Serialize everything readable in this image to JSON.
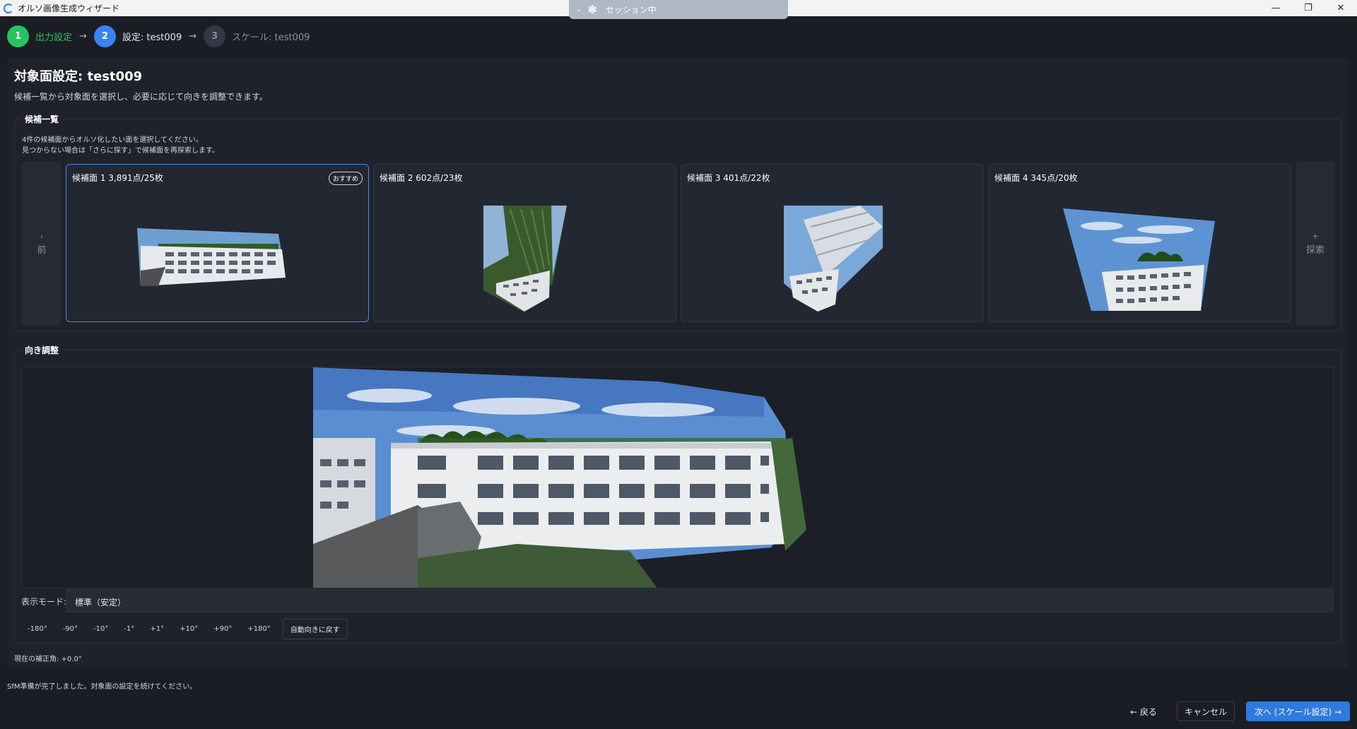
{
  "window": {
    "title": "オルソ画像生成ウィザード",
    "controls": [
      "—",
      "❐",
      "✕"
    ]
  },
  "session": {
    "label": "セッション中"
  },
  "steps": [
    {
      "number": "1",
      "label": "出力設定",
      "state": "done"
    },
    {
      "number": "2",
      "label": "設定: test009",
      "state": "active"
    },
    {
      "number": "3",
      "label": "スケール: test009",
      "state": "inactive"
    }
  ],
  "step_arrow": "→",
  "page": {
    "title": "対象面設定: test009",
    "description": "候補一覧から対象面を選択し、必要に応じて向きを調整できます。"
  },
  "candidates": {
    "group_title": "候補一覧",
    "hint_line1": "4件の候補面からオルソ化したい面を選択してください。",
    "hint_line2": "見つからない場合は「さらに探す」で候補面を再探索します。",
    "prev": {
      "symbol": "‹",
      "label": "前"
    },
    "explore": {
      "symbol": "+",
      "label": "探索"
    },
    "items": [
      {
        "label": "候補面 1 3,891点/25枚",
        "badge": "おすすめ",
        "selected": true
      },
      {
        "label": "候補面 2 602点/23枚",
        "selected": false
      },
      {
        "label": "候補面 3 401点/22枚",
        "selected": false
      },
      {
        "label": "候補面 4 345点/20枚",
        "selected": false
      }
    ]
  },
  "orientation": {
    "group_title": "向き調整",
    "mode_label": "表示モード:",
    "mode_value": "標準（安定）",
    "rotation_buttons": [
      "-180°",
      "-90°",
      "-10°",
      "-1°",
      "+1°",
      "+10°",
      "+90°",
      "+180°"
    ],
    "reset_label": "自動向きに戻す",
    "angle_text": "現在の補正角: +0.0°"
  },
  "status_text": "SfM準備が完了しました。対象面の設定を続けてください。",
  "footer": {
    "back_label": "← 戻る",
    "cancel_label": "キャンセル",
    "next_label": "次へ (スケール設定) →"
  },
  "colors": {
    "accent": "#2f7ae0",
    "done": "#22c55e",
    "active": "#3b82f6",
    "background": "#1b1d24"
  }
}
